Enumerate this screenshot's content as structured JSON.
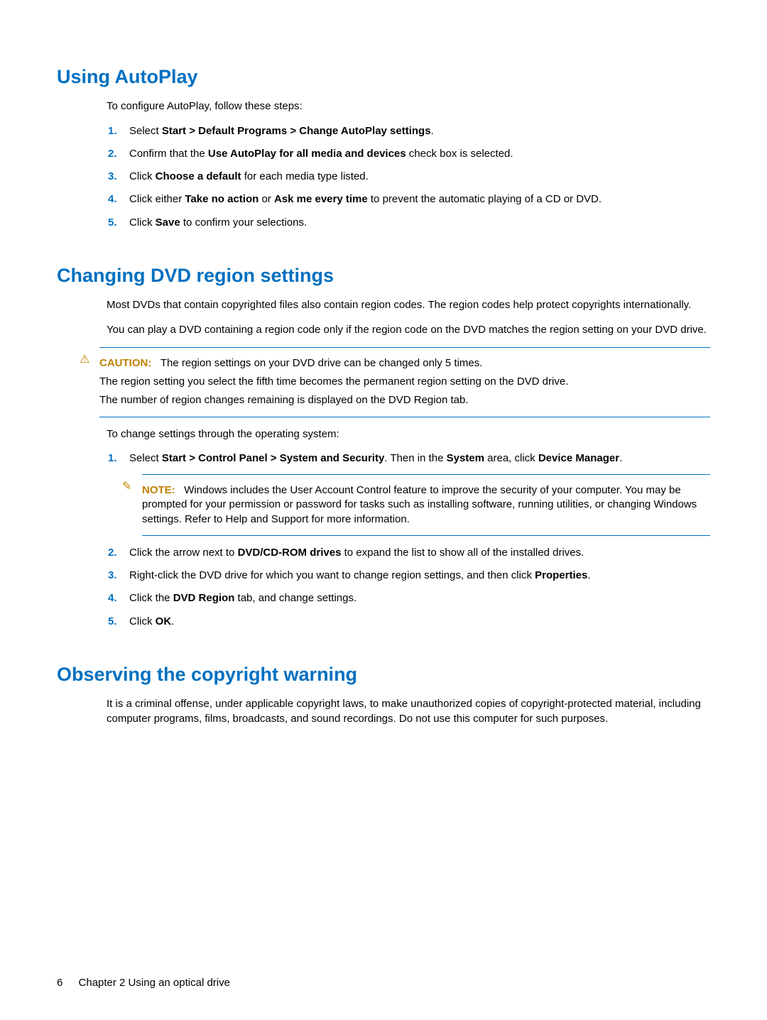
{
  "section1": {
    "title": "Using AutoPlay",
    "intro": "To configure AutoPlay, follow these steps:",
    "steps": {
      "s1_a": "Select ",
      "s1_b": "Start > Default Programs > Change AutoPlay settings",
      "s1_c": ".",
      "s2_a": "Confirm that the ",
      "s2_b": "Use AutoPlay for all media and devices",
      "s2_c": " check box is selected.",
      "s3_a": "Click ",
      "s3_b": "Choose a default",
      "s3_c": " for each media type listed.",
      "s4_a": "Click either ",
      "s4_b": "Take no action",
      "s4_c": " or ",
      "s4_d": "Ask me every time",
      "s4_e": " to prevent the automatic playing of a CD or DVD.",
      "s5_a": "Click ",
      "s5_b": "Save",
      "s5_c": " to confirm your selections."
    }
  },
  "section2": {
    "title": "Changing DVD region settings",
    "p1": "Most DVDs that contain copyrighted files also contain region codes. The region codes help protect copyrights internationally.",
    "p2": "You can play a DVD containing a region code only if the region code on the DVD matches the region setting on your DVD drive.",
    "caution": {
      "label": "CAUTION:",
      "l1": "The region settings on your DVD drive can be changed only 5 times.",
      "l2": "The region setting you select the fifth time becomes the permanent region setting on the DVD drive.",
      "l3": "The number of region changes remaining is displayed on the DVD Region tab."
    },
    "p3": "To change settings through the operating system:",
    "steps": {
      "s1_a": "Select ",
      "s1_b": "Start > Control Panel > System and Security",
      "s1_c": ". Then in the ",
      "s1_d": "System",
      "s1_e": " area, click ",
      "s1_f": "Device Manager",
      "s1_g": ".",
      "note_label": "NOTE:",
      "note_text": "Windows includes the User Account Control feature to improve the security of your computer. You may be prompted for your permission or password for tasks such as installing software, running utilities, or changing Windows settings. Refer to Help and Support for more information.",
      "s2_a": "Click the arrow next to ",
      "s2_b": "DVD/CD-ROM drives",
      "s2_c": " to expand the list to show all of the installed drives.",
      "s3_a": "Right-click the DVD drive for which you want to change region settings, and then click ",
      "s3_b": "Properties",
      "s3_c": ".",
      "s4_a": "Click the ",
      "s4_b": "DVD Region",
      "s4_c": " tab, and change settings.",
      "s5_a": "Click ",
      "s5_b": "OK",
      "s5_c": "."
    }
  },
  "section3": {
    "title": "Observing the copyright warning",
    "p1": "It is a criminal offense, under applicable copyright laws, to make unauthorized copies of copyright-protected material, including computer programs, films, broadcasts, and sound recordings. Do not use this computer for such purposes."
  },
  "footer": {
    "page": "6",
    "chapter": "Chapter 2   Using an optical drive"
  },
  "numbers": {
    "n1": "1.",
    "n2": "2.",
    "n3": "3.",
    "n4": "4.",
    "n5": "5."
  }
}
